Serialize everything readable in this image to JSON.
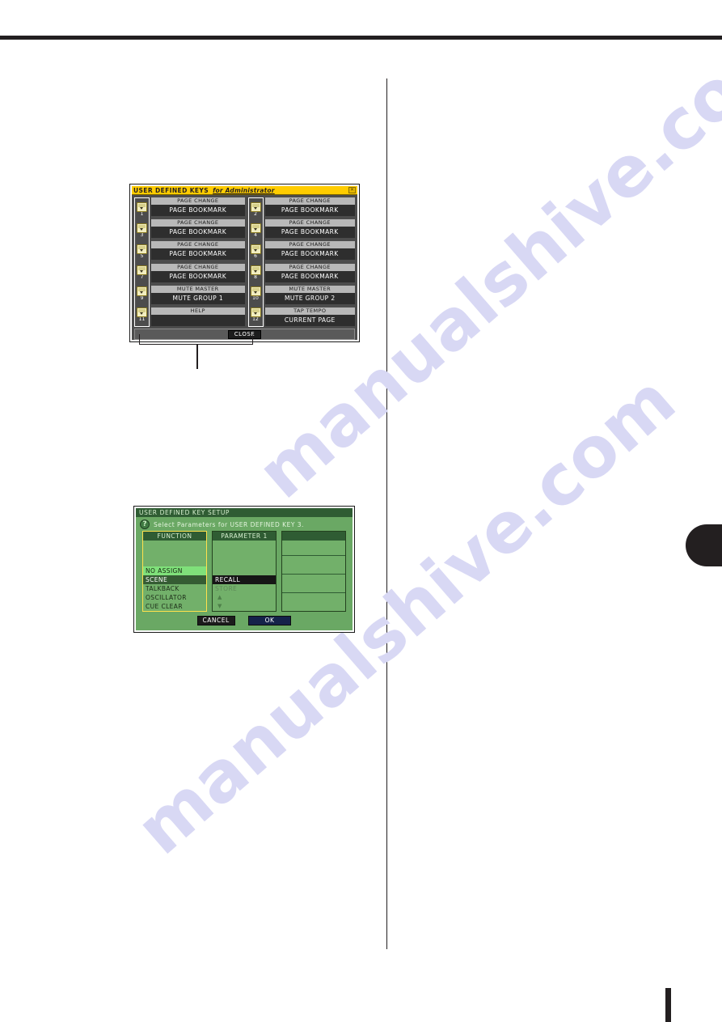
{
  "page": {
    "watermark_text": "manualshive.com"
  },
  "dialog_keys": {
    "title": "USER DEFINED KEYS",
    "subtitle": "for Administrator",
    "close_icon": "window-close-icon",
    "close_button_label": "CLOSE",
    "keys": [
      {
        "number": "1",
        "function": "PAGE CHANGE",
        "parameter": "PAGE BOOKMARK"
      },
      {
        "number": "2",
        "function": "PAGE CHANGE",
        "parameter": "PAGE BOOKMARK"
      },
      {
        "number": "3",
        "function": "PAGE CHANGE",
        "parameter": "PAGE BOOKMARK"
      },
      {
        "number": "4",
        "function": "PAGE CHANGE",
        "parameter": "PAGE BOOKMARK"
      },
      {
        "number": "5",
        "function": "PAGE CHANGE",
        "parameter": "PAGE BOOKMARK"
      },
      {
        "number": "6",
        "function": "PAGE CHANGE",
        "parameter": "PAGE BOOKMARK"
      },
      {
        "number": "7",
        "function": "PAGE CHANGE",
        "parameter": "PAGE BOOKMARK"
      },
      {
        "number": "8",
        "function": "PAGE CHANGE",
        "parameter": "PAGE BOOKMARK"
      },
      {
        "number": "9",
        "function": "MUTE MASTER",
        "parameter": "MUTE GROUP 1"
      },
      {
        "number": "10",
        "function": "MUTE MASTER",
        "parameter": "MUTE GROUP 2"
      },
      {
        "number": "11",
        "function": "HELP",
        "parameter": ""
      },
      {
        "number": "12",
        "function": "TAP TEMPO",
        "parameter": "CURRENT PAGE"
      }
    ]
  },
  "dialog_setup": {
    "title": "USER DEFINED KEY SETUP",
    "help_icon": "question-mark-icon",
    "prompt": "Select Parameters for USER DEFINED KEY 3.",
    "function_panel": {
      "header": "FUNCTION",
      "items": [
        {
          "label": "NO ASSIGN",
          "state": "highlight"
        },
        {
          "label": "SCENE",
          "state": "selected"
        },
        {
          "label": "TALKBACK",
          "state": "normal"
        },
        {
          "label": "OSCILLATOR",
          "state": "normal"
        },
        {
          "label": "CUE CLEAR",
          "state": "normal"
        }
      ]
    },
    "parameter_panel": {
      "header": "PARAMETER 1",
      "items": [
        {
          "label": "RECALL",
          "state": "sel-dark"
        },
        {
          "label": "STORE",
          "state": "dim"
        },
        {
          "label": "▲",
          "state": "arrow"
        },
        {
          "label": "▼",
          "state": "arrow"
        }
      ]
    },
    "third_panel": {
      "header": ""
    },
    "cancel_label": "CANCEL",
    "ok_label": "OK"
  }
}
